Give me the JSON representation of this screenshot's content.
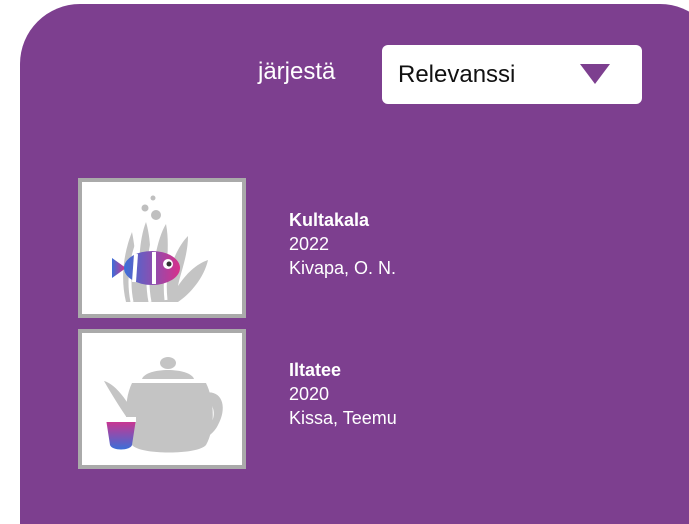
{
  "sort": {
    "label": "järjestä",
    "selected": "Relevanssi"
  },
  "results": [
    {
      "title": "Kultakala",
      "year": "2022",
      "author": "Kivapa, O. N.",
      "icon": "fish-coral-icon"
    },
    {
      "title": "Iltatee",
      "year": "2020",
      "author": "Kissa, Teemu",
      "icon": "teapot-icon"
    }
  ],
  "colors": {
    "background": "#7d3f8f",
    "text": "#ffffff",
    "thumb_border": "#aaaaaa",
    "gradient_start": "#3b6fd8",
    "gradient_end": "#d8308a"
  }
}
